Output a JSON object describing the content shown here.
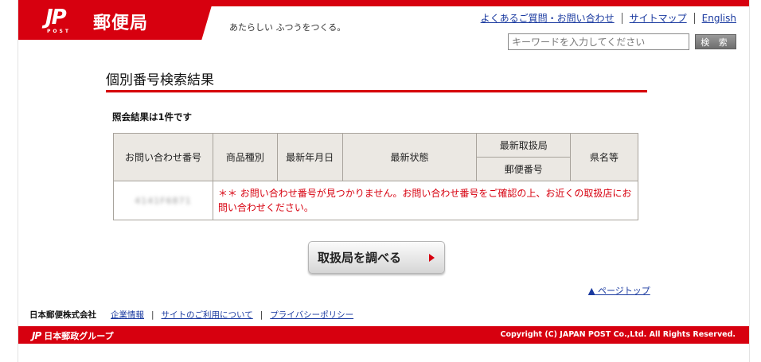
{
  "header": {
    "logo_mark": "JP",
    "logo_post": "POST",
    "logo_name": "郵便局",
    "tagline": "あたらしい ふつうをつくる。",
    "links": [
      "よくあるご質問・お問い合わせ",
      "サイトマップ",
      "English"
    ],
    "search_placeholder": "キーワードを入力してください",
    "search_button": "検 索"
  },
  "main": {
    "title": "個別番号検索結果",
    "result_count": "照会結果は1件です",
    "table": {
      "headers": {
        "inquiry_number": "お問い合わせ番号",
        "product_type": "商品種別",
        "latest_date": "最新年月日",
        "latest_status": "最新状態",
        "latest_office": "最新取扱局",
        "postal_code": "郵便番号",
        "prefecture": "県名等"
      },
      "row": {
        "inquiry_number_blurred": "4141F6871",
        "message": "＊＊ お問い合わせ番号が見つかりません。お問い合わせ番号をご確認の上、お近くの取扱店にお問い合わせください。"
      }
    },
    "lookup_button": "取扱局を調べる",
    "page_top": "▲ ページトップ"
  },
  "footer": {
    "company": "日本郵便株式会社",
    "links": [
      "企業情報",
      "サイトのご利用について",
      "プライバシーポリシー"
    ],
    "group_mark": "JP",
    "group_name": "日本郵政グループ",
    "copyright": "Copyright (C) JAPAN POST Co.,Ltd.  All Rights Reserved."
  },
  "colors": {
    "brand_red": "#d7000f",
    "link_blue": "#1a3aa0",
    "table_header_bg": "#ebe8e3"
  }
}
